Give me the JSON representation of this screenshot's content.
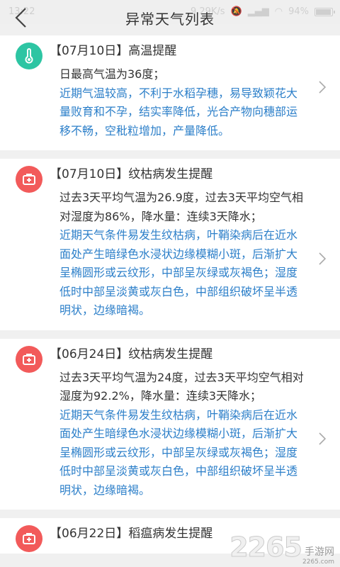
{
  "statusbar": {
    "time": "13:22",
    "net_speed": "9.29K/s",
    "battery": "94%",
    "battery_level": 0.94
  },
  "header": {
    "title": "异常天气列表",
    "back_icon": "chevron-left-icon"
  },
  "items": [
    {
      "icon": "thermometer-icon",
      "icon_color": "#2dc5a3",
      "title": "【07月10日】高温提醒",
      "desc": "日最高气温为36度；",
      "advice": "近期气温较高，不利于水稻孕穗，易导致颖花大量败育和不孕，结实率降低，光合产物向穗部运移不畅，空秕粒增加，产量降低。"
    },
    {
      "icon": "medical-kit-icon",
      "icon_color": "#f25a5a",
      "title": "【07月10日】纹枯病发生提醒",
      "desc": "过去3天平均气温为26.9度，过去3天平均空气相对湿度为86%，降水量：连续3天降水；",
      "advice": "近期天气条件易发生纹枯病，叶鞘染病后在近水面处产生暗绿色水浸状边缘模糊小斑，后渐扩大呈椭圆形或云纹形，中部呈灰绿或灰褐色；湿度低时中部呈淡黄或灰白色，中部组织破坏呈半透明状，边缘暗褐。"
    },
    {
      "icon": "medical-kit-icon",
      "icon_color": "#f25a5a",
      "title": "【06月24日】纹枯病发生提醒",
      "desc": "过去3天平均气温为24度，过去3天平均空气相对湿度为92.2%，降水量：连续3天降水；",
      "advice": "近期天气条件易发生纹枯病，叶鞘染病后在近水面处产生暗绿色水浸状边缘模糊小斑，后渐扩大呈椭圆形或云纹形，中部呈灰绿或灰褐色；湿度低时中部呈淡黄或灰白色，中部组织破坏呈半透明状，边缘暗褐。"
    },
    {
      "icon": "medical-kit-icon",
      "icon_color": "#f25a5a",
      "title": "【06月22日】稻瘟病发生提醒",
      "desc": "",
      "advice": ""
    }
  ],
  "watermark": {
    "brand": "2265",
    "suffix": "手游网",
    "url": "2265.com"
  }
}
